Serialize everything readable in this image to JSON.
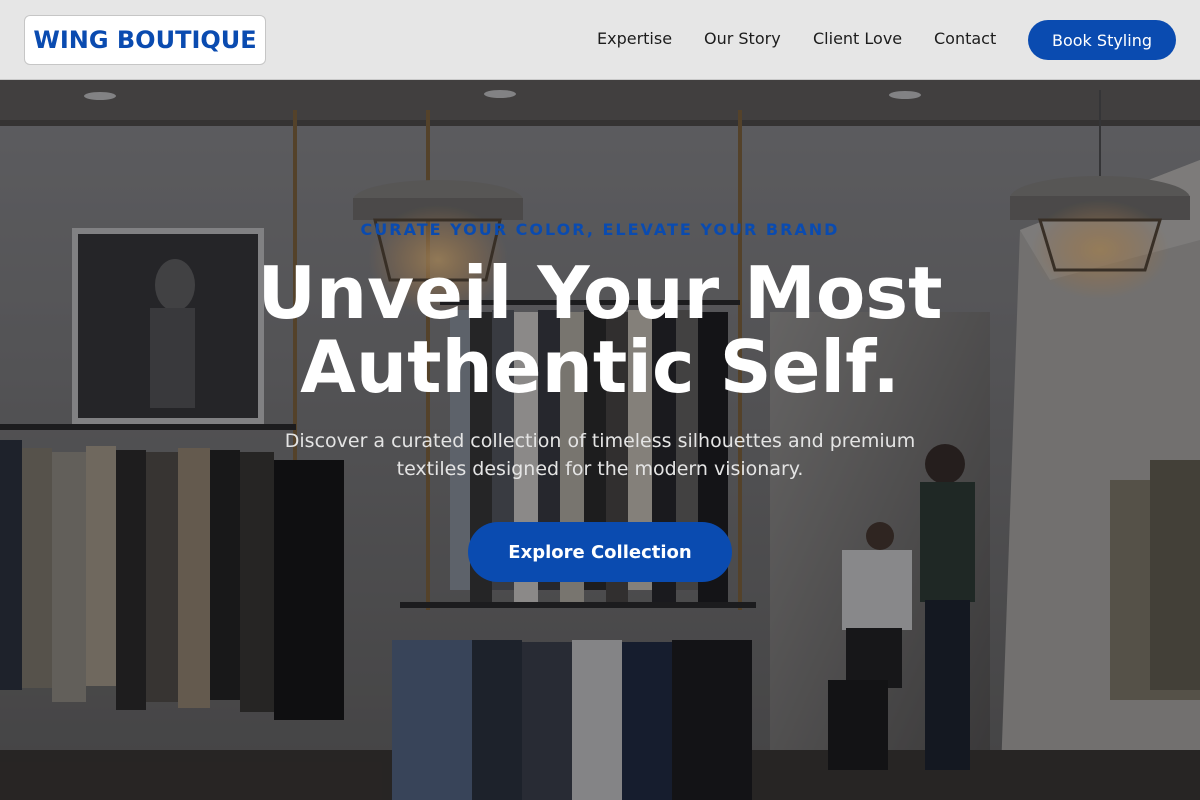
{
  "brand": {
    "name": "WING BOUTIQUE",
    "accent_color": "#0a4bb0"
  },
  "nav": {
    "items": [
      {
        "label": "Expertise"
      },
      {
        "label": "Our Story"
      },
      {
        "label": "Client Love"
      },
      {
        "label": "Contact"
      }
    ],
    "cta_label": "Book Styling"
  },
  "hero": {
    "eyebrow": "CURATE YOUR COLOR, ELEVATE YOUR BRAND",
    "headline": "Unveil Your Most Authentic Self.",
    "subtext": "Discover a curated collection of timeless silhouettes and premium textiles designed for the modern visionary.",
    "button_label": "Explore Collection",
    "background": "boutique-interior-photo"
  }
}
